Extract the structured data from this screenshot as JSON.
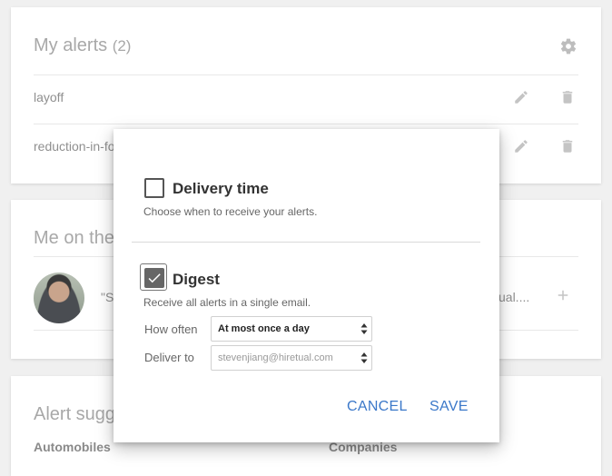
{
  "alerts_card": {
    "title": "My alerts",
    "count": "(2)",
    "items": [
      {
        "label": "layoff"
      },
      {
        "label": "reduction-in-fo"
      }
    ]
  },
  "me_card": {
    "title": "Me on the",
    "quote_start": "\"S",
    "truncated_tail": "ual...."
  },
  "suggest_card": {
    "title": "Alert sugg",
    "col1": "Automobiles",
    "col2": "Companies"
  },
  "modal": {
    "delivery": {
      "checked": false,
      "title": "Delivery time",
      "subtitle": "Choose when to receive your alerts."
    },
    "digest": {
      "checked": true,
      "title": "Digest",
      "subtitle": "Receive all alerts in a single email.",
      "how_often_label": "How often",
      "how_often_value": "At most once a day",
      "deliver_to_label": "Deliver to",
      "deliver_to_value": "stevenjiang@hiretual.com"
    },
    "cancel_label": "CANCEL",
    "save_label": "SAVE"
  },
  "colors": {
    "accent": "#3b78c9",
    "background": "#f0f0f0"
  }
}
